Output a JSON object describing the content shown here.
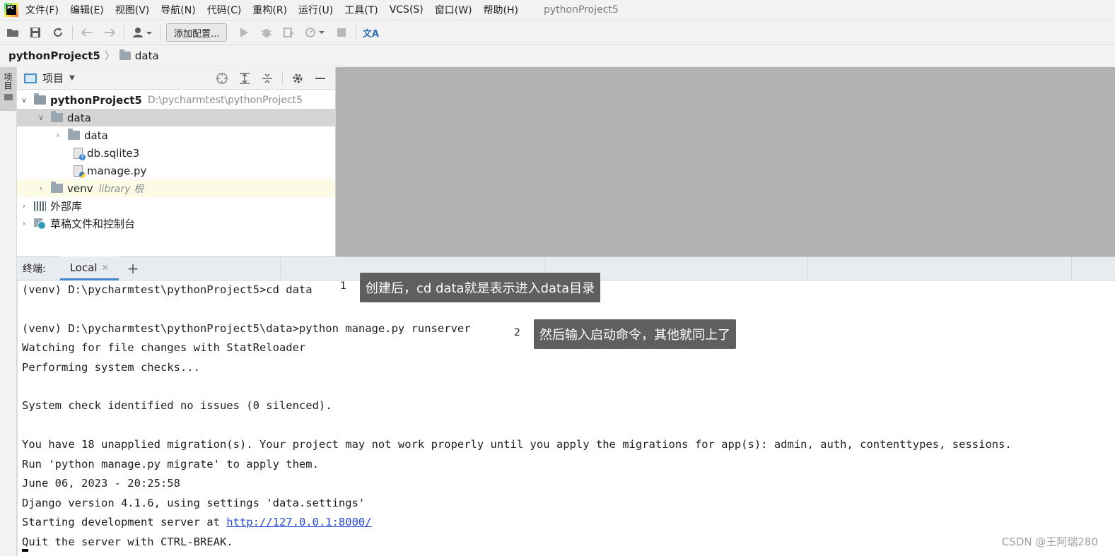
{
  "menubar": {
    "logo_text": "PC",
    "items": [
      "文件(F)",
      "编辑(E)",
      "视图(V)",
      "导航(N)",
      "代码(C)",
      "重构(R)",
      "运行(U)",
      "工具(T)",
      "VCS(S)",
      "窗口(W)",
      "帮助(H)"
    ],
    "window_title": "pythonProject5"
  },
  "toolbar": {
    "add_config_label": "添加配置...",
    "translate_icon": "文A"
  },
  "breadcrumb": {
    "project": "pythonProject5",
    "folder": "data"
  },
  "side_stripe": {
    "project_tab_label": "项目"
  },
  "project_panel": {
    "title": "项目",
    "tree": {
      "root_name": "pythonProject5",
      "root_path": "D:\\pycharmtest\\pythonProject5",
      "data_folder": "data",
      "data_subfolder": "data",
      "db_file": "db.sqlite3",
      "manage_file": "manage.py",
      "venv": "venv",
      "venv_hint": "library 根",
      "external_libs": "外部库",
      "scratches": "草稿文件和控制台"
    }
  },
  "terminal": {
    "label": "终端:",
    "tab_label": "Local",
    "lines": {
      "l1": "(venv) D:\\pycharmtest\\pythonProject5>cd data",
      "l2": "(venv) D:\\pycharmtest\\pythonProject5\\data>python manage.py runserver",
      "l3": "Watching for file changes with StatReloader",
      "l4": "Performing system checks...",
      "l5": "System check identified no issues (0 silenced).",
      "l6": "You have 18 unapplied migration(s). Your project may not work properly until you apply the migrations for app(s): admin, auth, contenttypes, sessions.",
      "l7": "Run 'python manage.py migrate' to apply them.",
      "l8": "June 06, 2023 - 20:25:58",
      "l9": "Django version 4.1.6, using settings 'data.settings'",
      "l10_prefix": "Starting development server at ",
      "l10_link": "http://127.0.0.1:8000/",
      "l11": "Quit the server with CTRL-BREAK."
    }
  },
  "annotations": {
    "n1": "1",
    "note1": "创建后，cd data就是表示进入data目录",
    "n2": "2",
    "note2": "然后输入启动命令，其他就同上了"
  },
  "watermark": "CSDN @王阿瑞280"
}
